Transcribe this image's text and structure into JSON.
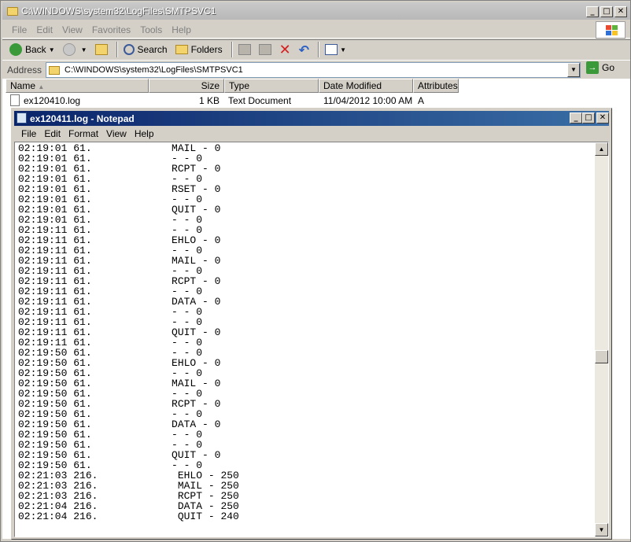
{
  "explorer": {
    "title": "C:\\WINDOWS\\system32\\LogFiles\\SMTPSVC1",
    "menu": [
      "File",
      "Edit",
      "View",
      "Favorites",
      "Tools",
      "Help"
    ],
    "toolbar": {
      "back": "Back",
      "search": "Search",
      "folders": "Folders"
    },
    "address": {
      "label": "Address",
      "value": "C:\\WINDOWS\\system32\\LogFiles\\SMTPSVC1",
      "go": "Go"
    },
    "columns": {
      "name": "Name",
      "size": "Size",
      "type": "Type",
      "date": "Date Modified",
      "attributes": "Attributes"
    },
    "file": {
      "name": "ex120410.log",
      "size": "1 KB",
      "type": "Text Document",
      "date": "11/04/2012 10:00 AM",
      "attributes": "A"
    }
  },
  "notepad": {
    "title": "ex120411.log - Notepad",
    "menu": [
      "File",
      "Edit",
      "Format",
      "View",
      "Help"
    ],
    "lines": [
      "02:19:01 61.             MAIL - 0",
      "02:19:01 61.             - - 0",
      "02:19:01 61.             RCPT - 0",
      "02:19:01 61.             - - 0",
      "02:19:01 61.             RSET - 0",
      "02:19:01 61.             - - 0",
      "02:19:01 61.             QUIT - 0",
      "02:19:01 61.             - - 0",
      "02:19:11 61.             - - 0",
      "02:19:11 61.             EHLO - 0",
      "02:19:11 61.             - - 0",
      "02:19:11 61.             MAIL - 0",
      "02:19:11 61.             - - 0",
      "02:19:11 61.             RCPT - 0",
      "02:19:11 61.             - - 0",
      "02:19:11 61.             DATA - 0",
      "02:19:11 61.             - - 0",
      "02:19:11 61.             - - 0",
      "02:19:11 61.             QUIT - 0",
      "02:19:11 61.             - - 0",
      "02:19:50 61.             - - 0",
      "02:19:50 61.             EHLO - 0",
      "02:19:50 61.             - - 0",
      "02:19:50 61.             MAIL - 0",
      "02:19:50 61.             - - 0",
      "02:19:50 61.             RCPT - 0",
      "02:19:50 61.             - - 0",
      "02:19:50 61.             DATA - 0",
      "02:19:50 61.             - - 0",
      "02:19:50 61.             - - 0",
      "02:19:50 61.             QUIT - 0",
      "02:19:50 61.             - - 0",
      "02:21:03 216.             EHLO - 250",
      "02:21:03 216.             MAIL - 250",
      "02:21:03 216.             RCPT - 250",
      "02:21:04 216.             DATA - 250",
      "02:21:04 216.             QUIT - 240"
    ]
  }
}
